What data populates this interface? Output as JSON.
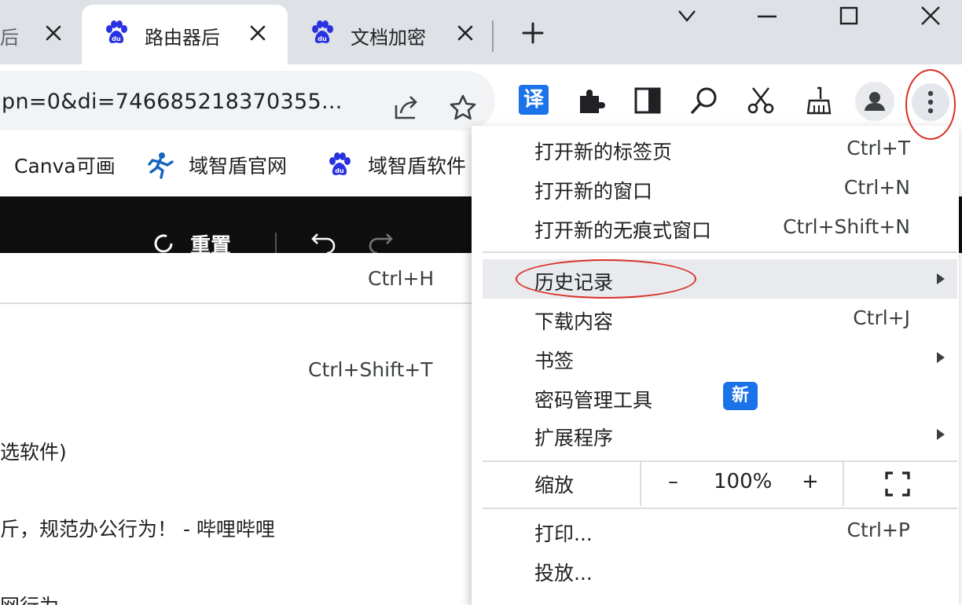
{
  "tabs": [
    {
      "title": "后",
      "favicon": "baidu-paw-icon"
    },
    {
      "title": "路由器后",
      "favicon": "baidu-paw-icon"
    },
    {
      "title": "文档加密",
      "favicon": "baidu-paw-icon"
    }
  ],
  "omnibox": {
    "url": "pn=0&di=746685218370355..."
  },
  "toolbar": {
    "translate_label": "译"
  },
  "bookmarks": [
    {
      "label": "Canva可画",
      "icon": ""
    },
    {
      "label": "域智盾官网",
      "icon": "runner-icon"
    },
    {
      "label": "域智盾软件",
      "icon": "baidu-paw-icon"
    }
  ],
  "page": {
    "reset_label": "重置"
  },
  "history_submenu": {
    "history_shortcut": "Ctrl+H",
    "reopen_shortcut": "Ctrl+Shift+T",
    "items": [
      "选软件)",
      "斤，规范办公行为！ - 哔哩哔哩",
      "网行为"
    ]
  },
  "chrome_menu": {
    "new_tab": {
      "label": "打开新的标签页",
      "shortcut": "Ctrl+T"
    },
    "new_window": {
      "label": "打开新的窗口",
      "shortcut": "Ctrl+N"
    },
    "incognito": {
      "label": "打开新的无痕式窗口",
      "shortcut": "Ctrl+Shift+N"
    },
    "history": {
      "label": "历史记录"
    },
    "downloads": {
      "label": "下载内容",
      "shortcut": "Ctrl+J"
    },
    "bookmarks": {
      "label": "书签"
    },
    "passwords": {
      "label": "密码管理工具",
      "badge": "新"
    },
    "extensions": {
      "label": "扩展程序"
    },
    "zoom": {
      "label": "缩放",
      "minus": "–",
      "value": "100%",
      "plus": "+"
    },
    "print": {
      "label": "打印...",
      "shortcut": "Ctrl+P"
    },
    "cast": {
      "label": "投放..."
    }
  },
  "colors": {
    "accent": "#1a73e8",
    "annotation": "#d93025",
    "tabstrip": "#dee1e6",
    "page_bar": "#0f0f0f"
  }
}
